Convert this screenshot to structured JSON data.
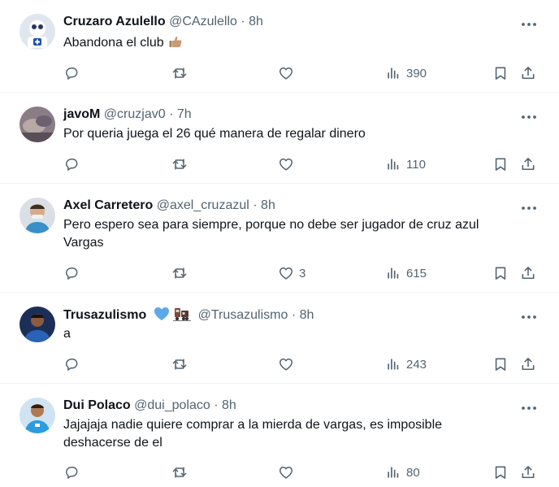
{
  "tweets": [
    {
      "name": "Cruzaro Azulello",
      "handle": "@CAzulello",
      "dot": "·",
      "time": "8h",
      "text": "Abandona el club",
      "replies": "",
      "retweets": "",
      "likes": "",
      "views": "390"
    },
    {
      "name": "javoM",
      "handle": "@cruzjav0",
      "dot": "·",
      "time": "7h",
      "text": "Por queria juega el 26 qué manera de regalar dinero",
      "replies": "",
      "retweets": "",
      "likes": "",
      "views": "110"
    },
    {
      "name": "Axel Carretero",
      "handle": "@axel_cruzazul",
      "dot": "·",
      "time": "8h",
      "text_line1": "Pero espero sea para siempre, porque no debe ser jugador de cruz azul",
      "text_line2": "Vargas",
      "replies": "",
      "retweets": "",
      "likes": "3",
      "views": "615"
    },
    {
      "name": "Trusazulismo",
      "handle": "@Trusazulismo",
      "dot": "·",
      "time": "8h",
      "text": "a",
      "replies": "",
      "retweets": "",
      "likes": "",
      "views": "243"
    },
    {
      "name": "Dui Polaco",
      "handle": "@dui_polaco",
      "dot": "·",
      "time": "8h",
      "text_line1": "Jajajaja nadie quiere comprar a la mierda de vargas, es imposible",
      "text_line2": "deshacerse de el",
      "replies": "",
      "retweets": "",
      "likes": "",
      "views": "80"
    }
  ],
  "icons": {
    "reply": "reply-icon",
    "retweet": "retweet-icon",
    "like": "heart-icon",
    "views": "views-icon",
    "bookmark": "bookmark-icon",
    "share": "share-icon",
    "more": "more-icon"
  },
  "colors": {
    "text": "#0f1419",
    "secondary": "#536471",
    "divider": "#eff3f4",
    "heart_badge": "#5ea8e8"
  }
}
